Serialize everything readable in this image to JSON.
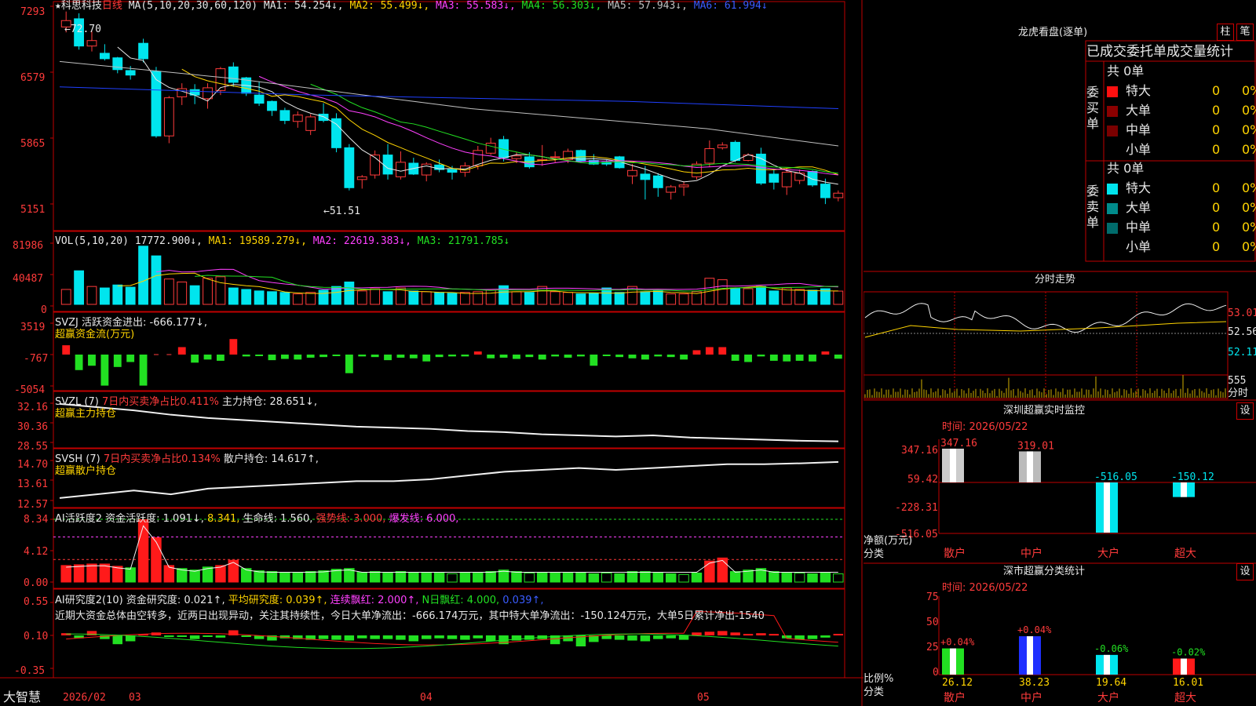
{
  "colors": {
    "up": "#ff3b3b",
    "down": "#00e5ee",
    "ma1": "#e8e8e8",
    "ma2": "#ffd400",
    "ma3": "#ff40ff",
    "ma4": "#22e022",
    "ma5": "#c0c0c0",
    "ma6": "#2040ff",
    "grid": "#c00000"
  },
  "header": {
    "star": "★",
    "stock_name": "科思科技",
    "period": "日线",
    "ma_label": "MA(5,10,20,30,60,120)",
    "ma1": "MA1: 54.254↓,",
    "ma2": "MA2: 55.499↓,",
    "ma3": "MA3: 55.583↓,",
    "ma4": "MA4: 56.303↓,",
    "ma5": "MA5: 57.943↓,",
    "ma6": "MA6: 61.994↓"
  },
  "price_panel": {
    "y_ticks": [
      "7293",
      "6579",
      "5865",
      "5151"
    ],
    "high_label": "←72.70",
    "low_label": "←51.51"
  },
  "vol_panel": {
    "label": "VOL(5,10,20)",
    "vol": "17772.900↓,",
    "ma1": "MA1: 19589.279↓,",
    "ma2": "MA2: 22619.383↓,",
    "ma3": "MA3: 21791.785↓",
    "y_ticks": [
      "81986",
      "40487",
      "0"
    ]
  },
  "svzj_panel": {
    "label": "SVZJ  活跃资金进出: -666.177↓,",
    "sub": "超赢资金流(万元)",
    "y_ticks": [
      "3519",
      "-767",
      "-5054"
    ]
  },
  "svzl_panel": {
    "label": "SVZL (7)",
    "ratio": "7日内买卖净占比0.411%",
    "hold": "主力持仓: 28.651↓,",
    "sub": "超赢主力持仓",
    "y_ticks": [
      "32.16",
      "30.36",
      "28.55"
    ]
  },
  "svsh_panel": {
    "label": "SVSH (7)",
    "ratio": "7日内买卖净占比0.134%",
    "hold": "散户持仓: 14.617↑,",
    "sub": "超赢散户持仓",
    "y_ticks": [
      "14.70",
      "13.61",
      "12.57"
    ]
  },
  "ai_panel": {
    "label": "AI活跃度2",
    "a": "资金活跃度: 1.091↓,",
    "b": "8.341,",
    "c": "生命线: 1.560,",
    "d": "强势线: 3.000,",
    "e": "爆发线: 6.000,",
    "y_ticks": [
      "8.34",
      "4.12",
      "0.00"
    ]
  },
  "research_panel": {
    "label": "AI研究度2(10)",
    "a": "资金研究度: 0.021↑,",
    "b": "平均研究度: 0.039↑,",
    "c": "连续飘红: 2.000↑,",
    "d": "N日飘红: 4.000,",
    "e": "0.039↑,",
    "comment": "近期大资金总体由空转多，近两日出现异动，关注其持续性，今日大单净流出：-666.174万元，其中特大单净流出：-150.124万元，大单5日累计净出-1540",
    "y_ticks": [
      "0.55",
      "0.10",
      "-0.35"
    ]
  },
  "bottom_bar": {
    "brand": "大智慧",
    "dates": [
      "2026/02",
      "03",
      "04",
      "05"
    ]
  },
  "dragon": {
    "title": "龙虎看盘(逐单)",
    "btn1": "柱",
    "btn2": "笔",
    "subtitle": "已成交委托单成交量统计",
    "buy_label": "委买单",
    "sell_label": "委卖单",
    "buy_total": "共 0单",
    "sell_total": "共 0单",
    "buy_rows": [
      {
        "name": "特大",
        "count": "0",
        "pct": "0%",
        "color": "#ff1010"
      },
      {
        "name": "大单",
        "count": "0",
        "pct": "0%",
        "color": "#8b0000"
      },
      {
        "name": "中单",
        "count": "0",
        "pct": "0%",
        "color": "#7a0000"
      },
      {
        "name": "小单",
        "count": "0",
        "pct": "0%",
        "color": ""
      }
    ],
    "sell_rows": [
      {
        "name": "特大",
        "count": "0",
        "pct": "0%",
        "color": "#00e5ee"
      },
      {
        "name": "大单",
        "count": "0",
        "pct": "0%",
        "color": "#008b8b"
      },
      {
        "name": "中单",
        "count": "0",
        "pct": "0%",
        "color": "#006b6b"
      },
      {
        "name": "小单",
        "count": "0",
        "pct": "0%",
        "color": ""
      }
    ]
  },
  "intraday": {
    "title": "分时走势",
    "y_ticks": [
      "53.01",
      "52.56",
      "52.11"
    ],
    "vol_tick": "555",
    "vol_label": "分时"
  },
  "sz_monitor": {
    "title": "深圳超赢实时监控",
    "btn": "设",
    "time": "时间: 2026/05/22",
    "unit_label": "净额(万元)",
    "class_label": "分类",
    "y_ticks": [
      "347.16",
      "59.42",
      "-228.31",
      "-516.05"
    ]
  },
  "sz_class": {
    "title": "深市超赢分类统计",
    "btn": "设",
    "time": "时间: 2026/05/22",
    "unit_label": "比例%",
    "class_label": "分类",
    "y_ticks": [
      "75",
      "50",
      "25",
      "0"
    ]
  },
  "chart_data": [
    {
      "type": "candlestick",
      "title": "科思科技 日线",
      "x": [
        "2026/02",
        "03",
        "04",
        "05"
      ],
      "ylim": [
        51.51,
        72.93
      ],
      "annotations": {
        "high": 72.7,
        "low": 51.51
      },
      "ma": {
        "MA1": 54.254,
        "MA2": 55.499,
        "MA3": 55.583,
        "MA4": 56.303,
        "MA5": 57.943,
        "MA6": 61.994
      },
      "candles": [
        [
          71.0,
          72.7,
          70.4,
          71.7
        ],
        [
          71.9,
          72.5,
          68.5,
          68.9
        ],
        [
          68.9,
          70.5,
          68.3,
          69.5
        ],
        [
          68.1,
          69.1,
          67.3,
          67.5
        ],
        [
          67.6,
          67.7,
          65.9,
          66.3
        ],
        [
          66.2,
          66.7,
          65.2,
          65.7
        ],
        [
          69.2,
          69.7,
          67.1,
          67.5
        ],
        [
          66.1,
          66.6,
          58.8,
          59.0
        ],
        [
          59.0,
          63.4,
          58.2,
          63.2
        ],
        [
          63.3,
          64.8,
          62.4,
          64.2
        ],
        [
          64.1,
          64.7,
          62.5,
          63.5
        ],
        [
          63.1,
          64.8,
          62.0,
          64.3
        ],
        [
          64.0,
          66.6,
          63.5,
          66.4
        ],
        [
          66.6,
          67.1,
          64.4,
          64.9
        ],
        [
          65.4,
          65.5,
          63.4,
          63.7
        ],
        [
          63.5,
          65.0,
          62.3,
          62.6
        ],
        [
          62.8,
          62.9,
          61.2,
          61.8
        ],
        [
          61.8,
          62.1,
          60.3,
          60.7
        ],
        [
          60.6,
          61.7,
          59.9,
          61.3
        ],
        [
          59.6,
          61.4,
          59.1,
          61.1
        ],
        [
          61.4,
          62.6,
          60.5,
          60.7
        ],
        [
          60.9,
          61.5,
          57.2,
          57.7
        ],
        [
          57.7,
          58.1,
          53.0,
          53.3
        ],
        [
          54.2,
          54.7,
          53.2,
          54.5
        ],
        [
          54.7,
          57.4,
          54.3,
          56.9
        ],
        [
          56.9,
          58.1,
          54.2,
          54.8
        ],
        [
          54.5,
          57.3,
          54.2,
          56.1
        ],
        [
          56.0,
          56.6,
          54.7,
          54.8
        ],
        [
          54.7,
          56.1,
          54.0,
          55.9
        ],
        [
          55.8,
          56.4,
          55.0,
          55.3
        ],
        [
          55.3,
          55.7,
          54.2,
          55.0
        ],
        [
          55.0,
          56.1,
          54.5,
          55.7
        ],
        [
          55.7,
          57.9,
          55.3,
          57.4
        ],
        [
          57.1,
          58.8,
          56.9,
          58.2
        ],
        [
          58.6,
          59.0,
          56.2,
          56.6
        ],
        [
          56.5,
          57.2,
          56.0,
          56.8
        ],
        [
          56.7,
          57.2,
          55.4,
          55.6
        ],
        [
          56.3,
          58.0,
          55.7,
          56.4
        ],
        [
          56.7,
          57.3,
          56.1,
          56.7
        ],
        [
          56.4,
          57.6,
          56.0,
          57.3
        ],
        [
          57.4,
          57.5,
          56.1,
          56.2
        ],
        [
          56.3,
          57.0,
          55.8,
          55.9
        ],
        [
          56.1,
          56.4,
          55.7,
          55.9
        ],
        [
          56.7,
          56.8,
          55.4,
          55.5
        ],
        [
          54.6,
          55.9,
          53.7,
          55.2
        ],
        [
          54.8,
          55.7,
          52.0,
          54.2
        ],
        [
          54.6,
          54.9,
          52.3,
          53.3
        ],
        [
          52.8,
          53.6,
          52.0,
          53.4
        ],
        [
          53.4,
          54.0,
          52.4,
          53.6
        ],
        [
          54.5,
          56.2,
          54.2,
          55.9
        ],
        [
          56.0,
          58.5,
          55.6,
          57.6
        ],
        [
          57.7,
          58.3,
          57.5,
          58.0
        ],
        [
          58.3,
          58.5,
          56.1,
          56.3
        ],
        [
          56.3,
          57.1,
          56.2,
          56.9
        ],
        [
          57.0,
          57.7,
          53.6,
          53.8
        ],
        [
          54.8,
          55.4,
          53.1,
          53.9
        ],
        [
          53.4,
          55.4,
          52.5,
          55.0
        ],
        [
          54.1,
          55.3,
          53.7,
          54.9
        ],
        [
          55.1,
          55.2,
          53.4,
          53.6
        ],
        [
          53.7,
          54.3,
          51.5,
          52.2
        ],
        [
          52.2,
          53.0,
          51.8,
          52.7
        ]
      ]
    },
    {
      "type": "bar",
      "title": "VOL(5,10,20)",
      "ylim": [
        0,
        81986
      ],
      "values": [
        20000,
        45000,
        24000,
        22000,
        26000,
        23000,
        78000,
        65000,
        34000,
        30000,
        25000,
        35000,
        37000,
        22000,
        20000,
        18000,
        17000,
        16000,
        14000,
        16000,
        19000,
        24000,
        30000,
        18000,
        21000,
        17000,
        22000,
        18000,
        17000,
        16000,
        15000,
        16000,
        17000,
        19000,
        25000,
        17000,
        16000,
        24000,
        17000,
        16000,
        14000,
        15000,
        22000,
        16000,
        24000,
        17000,
        18000,
        14000,
        14000,
        17000,
        35000,
        33000,
        22000,
        21000,
        24000,
        18000,
        22000,
        20000,
        19000,
        21000,
        17773
      ]
    },
    {
      "type": "bar",
      "title": "SVZJ 超赢资金流(万元)",
      "ylim": [
        -5054,
        3519
      ],
      "values": [
        1500,
        -2500,
        -1800,
        -5000,
        -2000,
        -1200,
        -5000,
        0,
        0,
        1200,
        -1300,
        -800,
        -1000,
        2500,
        -300,
        -200,
        -900,
        -700,
        -800,
        -500,
        -400,
        -200,
        -3000,
        -300,
        -400,
        -900,
        -500,
        -600,
        -1100,
        -400,
        -300,
        -300,
        500,
        -600,
        -500,
        -700,
        -400,
        -800,
        -300,
        -500,
        -300,
        -1800,
        -200,
        -400,
        -600,
        -800,
        -300,
        -400,
        -800,
        700,
        1200,
        1200,
        -1000,
        -1200,
        -300,
        -1000,
        -1100,
        -1000,
        -1100,
        500,
        -666
      ]
    },
    {
      "type": "line",
      "title": "SVZL 超赢主力持仓",
      "ylim": [
        28.55,
        32.16
      ],
      "values": [
        32.1,
        31.8,
        31.5,
        31.1,
        30.8,
        30.6,
        30.4,
        30.2,
        30.0,
        29.9,
        29.8,
        29.6,
        29.5,
        29.3,
        29.2,
        29.1,
        29.2,
        29.0,
        28.9,
        28.8,
        28.7,
        28.65
      ]
    },
    {
      "type": "line",
      "title": "SVSH 超赢散户持仓",
      "ylim": [
        12.57,
        14.7
      ],
      "values": [
        12.7,
        12.9,
        13.1,
        12.9,
        13.2,
        13.3,
        13.4,
        13.5,
        13.6,
        13.6,
        13.7,
        13.9,
        14.1,
        14.2,
        14.3,
        14.2,
        14.3,
        14.4,
        14.5,
        14.5,
        14.55,
        14.62
      ]
    },
    {
      "type": "bar",
      "title": "AI活跃度2",
      "ylim": [
        0,
        8.34
      ],
      "values": [
        2.2,
        2.3,
        2.4,
        2.4,
        2.1,
        1.9,
        8.3,
        5.9,
        2.2,
        1.8,
        1.6,
        2.0,
        2.2,
        2.9,
        1.8,
        1.5,
        1.4,
        1.3,
        1.3,
        1.4,
        1.5,
        1.7,
        1.8,
        1.3,
        1.4,
        1.3,
        1.4,
        1.3,
        1.2,
        1.2,
        1.1,
        1.2,
        1.3,
        1.4,
        1.6,
        1.4,
        1.2,
        1.3,
        1.3,
        1.3,
        1.2,
        1.1,
        1.2,
        1.1,
        1.4,
        1.4,
        1.2,
        1.1,
        1.0,
        1.2,
        2.8,
        3.2,
        1.4,
        1.6,
        1.8,
        1.4,
        1.3,
        1.2,
        1.1,
        1.2,
        1.091
      ]
    },
    {
      "type": "bar",
      "title": "AI研究度2(10)",
      "ylim": [
        -0.35,
        0.55
      ],
      "values": [
        0.03,
        -0.04,
        0.06,
        -0.05,
        -0.12,
        -0.08,
        0.02,
        0.04,
        0.0,
        -0.02,
        -0.05,
        0.0,
        -0.03,
        0.07,
        -0.02,
        -0.05,
        -0.07,
        -0.04,
        -0.05,
        -0.06,
        -0.05,
        -0.06,
        -0.07,
        -0.04,
        -0.05,
        -0.05,
        -0.06,
        -0.08,
        -0.05,
        -0.04,
        -0.05,
        -0.06,
        -0.04,
        -0.08,
        -0.12,
        -0.07,
        -0.06,
        -0.05,
        -0.12,
        -0.08,
        -0.15,
        -0.09,
        -0.05,
        -0.06,
        -0.07,
        -0.08,
        -0.05,
        -0.04,
        -0.06,
        0.04,
        0.05,
        0.06,
        0.04,
        0.02,
        0.03,
        0.02,
        -0.04,
        -0.06,
        -0.05,
        -0.03,
        0.021
      ]
    },
    {
      "type": "bar",
      "title": "深圳超赢实时监控",
      "categories": [
        "散户",
        "中户",
        "大户",
        "超大"
      ],
      "values": [
        347.16,
        319.01,
        -516.05,
        -150.12
      ],
      "ylim": [
        -516.05,
        347.16
      ],
      "ylabel": "净额(万元)"
    },
    {
      "type": "bar",
      "title": "深市超赢分类统计",
      "categories": [
        "散户",
        "中户",
        "大户",
        "超大"
      ],
      "values": [
        26.12,
        38.23,
        19.64,
        16.01
      ],
      "changes": [
        "+0.04%",
        "+0.04%",
        "-0.06%",
        "-0.02%"
      ],
      "ylim": [
        0,
        75
      ],
      "ylabel": "比例%"
    }
  ]
}
